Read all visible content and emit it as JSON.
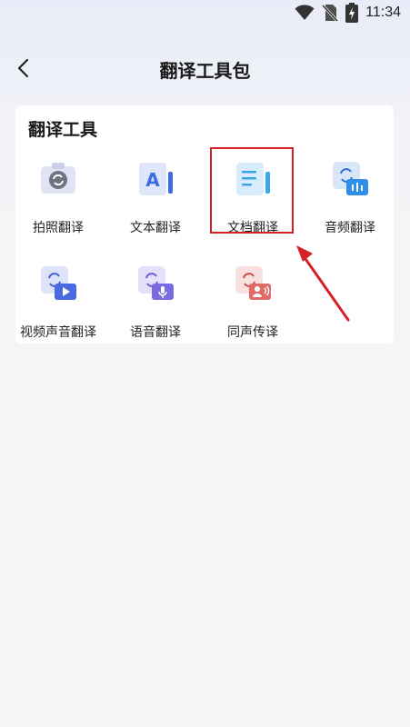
{
  "status": {
    "time": "11:34",
    "icons": [
      "wifi-icon",
      "no-sim-icon",
      "battery-charging-icon"
    ]
  },
  "header": {
    "title": "翻译工具包",
    "back_icon": "back-arrow-icon"
  },
  "tools_section": {
    "title": "翻译工具",
    "items": [
      {
        "label": "拍照翻译",
        "icon": "camera-icon",
        "color": "#4a5dc9"
      },
      {
        "label": "文本翻译",
        "icon": "text-a-icon",
        "color": "#3b6fe0"
      },
      {
        "label": "文档翻译",
        "icon": "document-icon",
        "color": "#3aa6e8",
        "highlighted": true
      },
      {
        "label": "音频翻译",
        "icon": "audio-icon",
        "color": "#2f8fe8"
      },
      {
        "label": "视频声音翻译",
        "icon": "video-icon",
        "color": "#4a6be0"
      },
      {
        "label": "语音翻译",
        "icon": "microphone-icon",
        "color": "#6a5bd6"
      },
      {
        "label": "同声传译",
        "icon": "simultaneous-interpretation-icon",
        "color": "#e06a6a"
      }
    ]
  },
  "annotation": {
    "color": "#d62027"
  }
}
